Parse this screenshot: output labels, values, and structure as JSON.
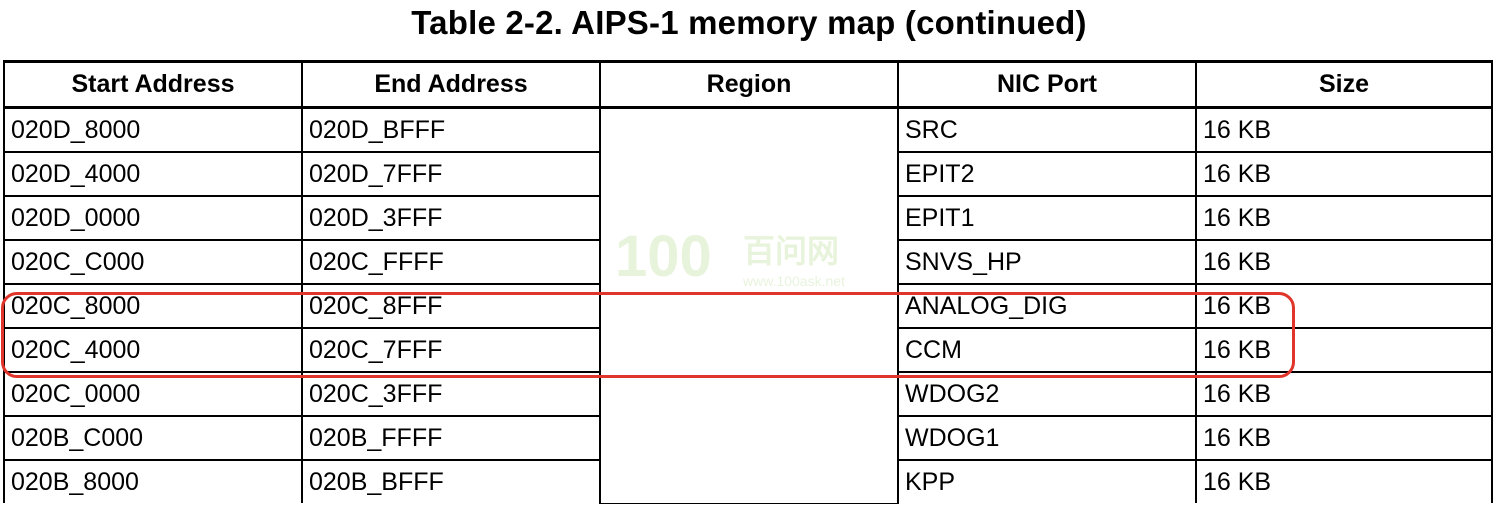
{
  "caption": "Table 2-2.   AIPS-1 memory map (continued)",
  "table": {
    "headers": [
      "Start Address",
      "End Address",
      "Region",
      "NIC Port",
      "Size"
    ],
    "rows": [
      {
        "start": "020D_8000",
        "end": "020D_BFFF",
        "nic": "SRC",
        "size": "16 KB"
      },
      {
        "start": "020D_4000",
        "end": "020D_7FFF",
        "nic": "EPIT2",
        "size": "16 KB"
      },
      {
        "start": "020D_0000",
        "end": "020D_3FFF",
        "nic": "EPIT1",
        "size": "16 KB"
      },
      {
        "start": "020C_C000",
        "end": "020C_FFFF",
        "nic": "SNVS_HP",
        "size": "16 KB"
      },
      {
        "start": "020C_8000",
        "end": "020C_8FFF",
        "nic": "ANALOG_DIG",
        "size": "16 KB"
      },
      {
        "start": "020C_4000",
        "end": "020C_7FFF",
        "nic": "CCM",
        "size": "16 KB"
      },
      {
        "start": "020C_0000",
        "end": "020C_3FFF",
        "nic": "WDOG2",
        "size": "16 KB"
      },
      {
        "start": "020B_C000",
        "end": "020B_FFFF",
        "nic": "WDOG1",
        "size": "16 KB"
      },
      {
        "start": "020B_8000",
        "end": "020B_BFFF",
        "nic": "KPP",
        "size": "16 KB"
      }
    ]
  },
  "watermark": {
    "logo_text": "100",
    "brand_text": "百问网",
    "url_text": "www.100ask.net",
    "color": "#7fbf3f"
  },
  "highlight": {
    "color": "#e0352b"
  }
}
